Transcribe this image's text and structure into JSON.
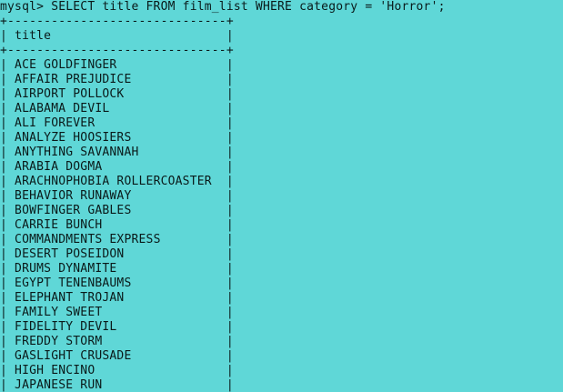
{
  "terminal": {
    "prompt": "mysql> ",
    "command": "SELECT title FROM film_list WHERE category = 'Horror';",
    "border": "+------------------------------+",
    "column_header": "title",
    "rows": [
      "ACE GOLDFINGER",
      "AFFAIR PREJUDICE",
      "AIRPORT POLLOCK",
      "ALABAMA DEVIL",
      "ALI FOREVER",
      "ANALYZE HOOSIERS",
      "ANYTHING SAVANNAH",
      "ARABIA DOGMA",
      "ARACHNOPHOBIA ROLLERCOASTER",
      "BEHAVIOR RUNAWAY",
      "BOWFINGER GABLES",
      "CARRIE BUNCH",
      "COMMANDMENTS EXPRESS",
      "DESERT POSEIDON",
      "DRUMS DYNAMITE",
      "EGYPT TENENBAUMS",
      "ELEPHANT TROJAN",
      "FAMILY SWEET",
      "FIDELITY DEVIL",
      "FREDDY STORM",
      "GASLIGHT CRUSADE",
      "HIGH ENCINO",
      "JAPANESE RUN"
    ],
    "colors": {
      "background": "#5fd7d7",
      "text": "#0a1a1a"
    }
  }
}
